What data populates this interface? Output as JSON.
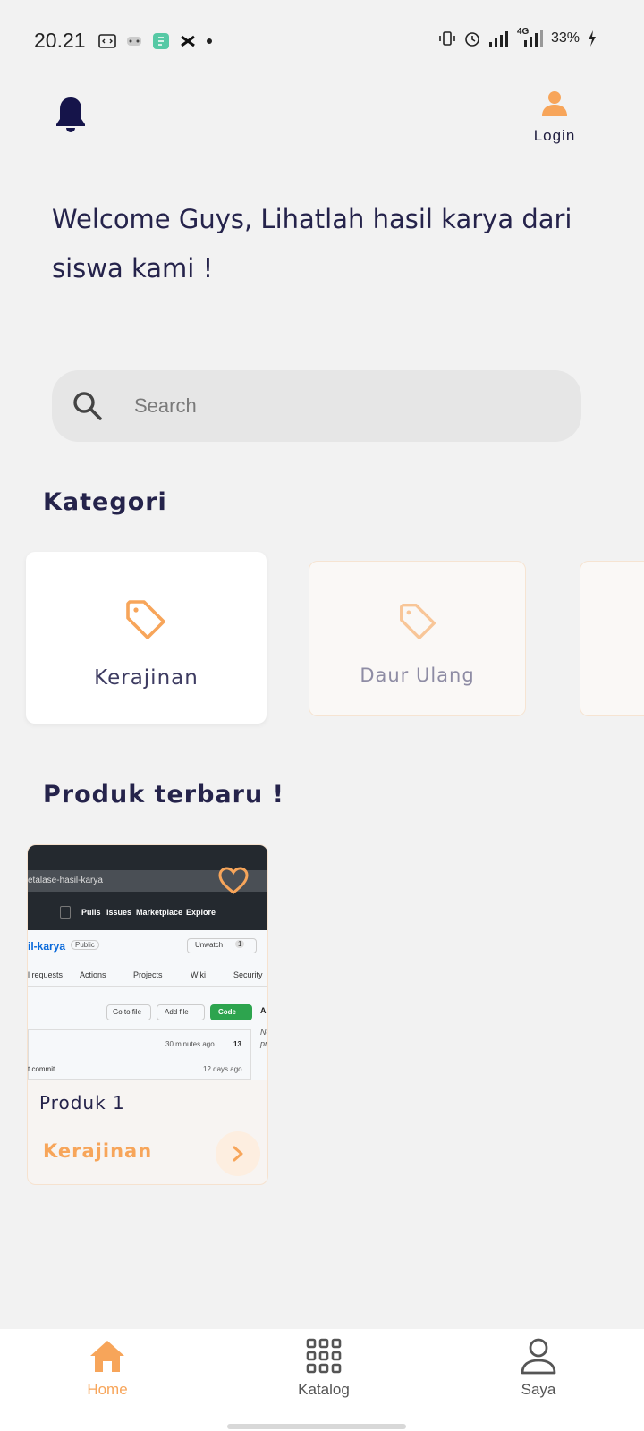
{
  "status_bar": {
    "time": "20.21",
    "battery": "33%",
    "network": "4G",
    "left_icons": [
      "code-notification-icon",
      "game-notification-icon",
      "app-notification-icon",
      "capcut-notification-icon",
      "more-dot-icon"
    ],
    "right_icons": [
      "vibrate-icon",
      "alarm-icon",
      "signal-icon",
      "signal-4g-icon",
      "charging-icon"
    ]
  },
  "header": {
    "login_label": "Login"
  },
  "welcome_text": "Welcome Guys, Lihatlah hasil karya dari siswa kami !",
  "search": {
    "placeholder": "Search"
  },
  "categories_section": {
    "title": "Kategori",
    "items": [
      {
        "label": "Kerajinan",
        "active": true
      },
      {
        "label": "Daur Ulang",
        "active": false
      }
    ]
  },
  "products_section": {
    "title": "Produk terbaru !",
    "items": [
      {
        "name": "Produk 1",
        "category": "Kerajinan",
        "screenshot_text": {
          "repo_hint": "etalase-hasil-karya",
          "nav": [
            "Pulls",
            "Issues",
            "Marketplace",
            "Explore"
          ],
          "repo_name": "il-karya",
          "visibility": "Public",
          "unwatch": "Unwatch",
          "unwatch_count": "1",
          "tabs": [
            "l requests",
            "Actions",
            "Projects",
            "Wiki",
            "Security"
          ],
          "buttons": [
            "Go to file",
            "Add file",
            "Code"
          ],
          "about": "Ab",
          "about_lines": [
            "No",
            "pro"
          ],
          "time_ago": "30 minutes ago",
          "commit_count": "13",
          "last_commit": "t commit",
          "days_ago": "12 days ago"
        }
      }
    ]
  },
  "bottom_nav": {
    "items": [
      {
        "label": "Home",
        "icon": "home-icon",
        "active": true
      },
      {
        "label": "Katalog",
        "icon": "grid-icon",
        "active": false
      },
      {
        "label": "Saya",
        "icon": "user-icon",
        "active": false
      }
    ]
  },
  "colors": {
    "accent": "#f7a55a",
    "text_dark": "#25234b",
    "background": "#f2f2f2",
    "nav_inactive": "#555555"
  }
}
